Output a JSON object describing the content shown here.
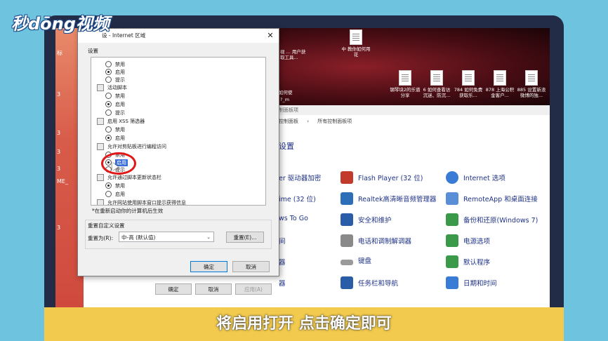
{
  "logo": "秒dōng视频",
  "dialog": {
    "title": "设 - Internet 区域",
    "close": "✕",
    "settings_label": "设置",
    "tree": [
      {
        "type": "radio",
        "label": "禁用",
        "checked": false
      },
      {
        "type": "radio",
        "label": "启用",
        "checked": true
      },
      {
        "type": "radio",
        "label": "提示",
        "checked": false
      },
      {
        "type": "group",
        "label": "活动脚本"
      },
      {
        "type": "radio",
        "label": "禁用",
        "checked": false
      },
      {
        "type": "radio",
        "label": "启用",
        "checked": true
      },
      {
        "type": "radio",
        "label": "提示",
        "checked": false
      },
      {
        "type": "group",
        "label": "启用 XSS 筛选器"
      },
      {
        "type": "radio",
        "label": "禁用",
        "checked": false
      },
      {
        "type": "radio",
        "label": "启用",
        "checked": true
      },
      {
        "type": "group",
        "label": "允许对剪贴板进行编程访问"
      },
      {
        "type": "radio",
        "label": "禁用",
        "checked": false
      },
      {
        "type": "radio",
        "label": "启用",
        "checked": true,
        "highlight": true
      },
      {
        "type": "radio",
        "label": "提示",
        "checked": false
      },
      {
        "type": "group",
        "label": "允许通过脚本更新状态栏"
      },
      {
        "type": "radio",
        "label": "禁用",
        "checked": true
      },
      {
        "type": "radio",
        "label": "启用",
        "checked": false
      },
      {
        "type": "group",
        "label": "允许网站使用脚本窗口提示获得信息"
      }
    ],
    "note": "*在重新启动你的计算机后生效",
    "reset_group_label": "重置自定义设置",
    "reset_to_label": "重置为(R):",
    "reset_select_value": "中-高 (默认值)",
    "reset_button": "重置(E)...",
    "ok_button": "确定",
    "cancel_button": "取消"
  },
  "back_dialog": {
    "ok": "确定",
    "cancel": "取消",
    "apply": "应用(A)"
  },
  "desktop": {
    "left_labels": [
      "标",
      "3",
      "3",
      "3",
      "3",
      "ME_",
      "3"
    ],
    "icons": [
      {
        "label": "中 教你如何用花"
      },
      {
        "label": "钢琴块2的乐谱分享"
      },
      {
        "label": "6 如何查看访沉迷、防沉..."
      },
      {
        "label": "784 如何免费获取乐..."
      },
      {
        "label": "878 上海公积金客户..."
      },
      {
        "label": "885 设置新浪微博的独..."
      }
    ],
    "partial_texts": [
      "视 ... 用户获取工具...",
      "如何使",
      "?_m"
    ]
  },
  "control_panel": {
    "bar_text": "制面板项",
    "breadcrumb": [
      "控制面板",
      "所有控制面板项"
    ],
    "heading": "设置",
    "items": [
      {
        "label": "er 驱动器加密",
        "color": "#1e3287"
      },
      {
        "label": "Flash Player (32 位)",
        "color": "#c23a2b"
      },
      {
        "label": "Internet 选项",
        "color": "#3a7bd5"
      },
      {
        "label": "ime (32 位)",
        "color": "#1e3287"
      },
      {
        "label": "Realtek高清晰音频管理器",
        "color": "#2c6fb8"
      },
      {
        "label": "RemoteApp 和桌面连接",
        "color": "#3a7bd5"
      },
      {
        "label": "ws To Go",
        "color": "#1e3287"
      },
      {
        "label": "安全和维护",
        "color": "#2a5da8"
      },
      {
        "label": "备份和还原(Windows 7)",
        "color": "#3a9a4a"
      },
      {
        "label": "间",
        "color": "#1e3287"
      },
      {
        "label": "电话和调制解调器",
        "color": "#666666"
      },
      {
        "label": "电源选项",
        "color": "#3a9a4a"
      },
      {
        "label": "器",
        "color": "#1e3287"
      },
      {
        "label": "键盘",
        "color": "#777777"
      },
      {
        "label": "默认程序",
        "color": "#3a9a4a"
      },
      {
        "label": "器",
        "color": "#1e3287"
      },
      {
        "label": "任务栏和导航",
        "color": "#2a5da8"
      },
      {
        "label": "日期和时间",
        "color": "#3a7bd5"
      }
    ]
  },
  "subtitle": "将启用打开 点击确定即可"
}
